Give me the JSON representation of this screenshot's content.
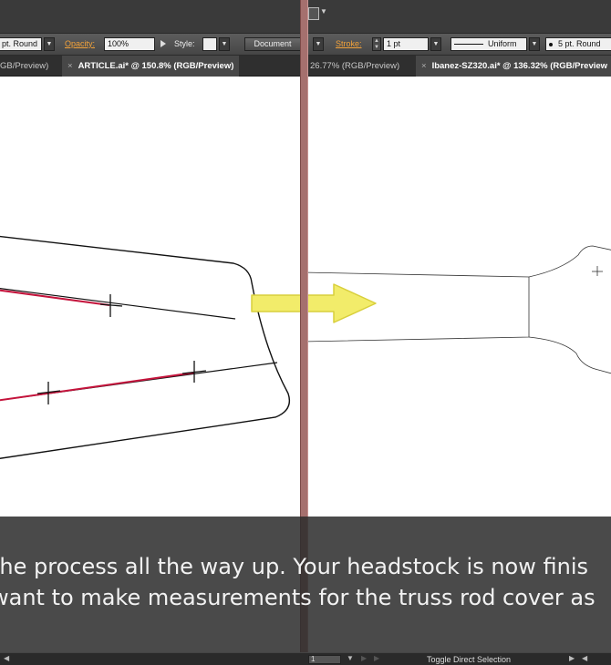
{
  "control_bar": {
    "brush_value": "pt. Round",
    "opacity_label": "Opacity:",
    "opacity_value": "100%",
    "style_label": "Style:",
    "document_label": "Document",
    "stroke_label": "Stroke:",
    "stroke_weight": "1 pt",
    "profile_value": "Uniform",
    "brush2_value": "5 pt. Round"
  },
  "left_tabs": [
    {
      "label": "GB/Preview)"
    },
    {
      "label": "ARTICLE.ai* @ 150.8% (RGB/Preview)",
      "close": "×"
    }
  ],
  "right_tabs": [
    {
      "label": "26.77% (RGB/Preview)"
    },
    {
      "label": "Ibanez-SZ320.ai* @ 136.32% (RGB/Preview",
      "close": "×"
    }
  ],
  "caption": {
    "line1": "the process all the way up. Your headstock is now finis",
    "line2": "want to make measurements for the truss rod cover as"
  },
  "status_bar": {
    "zoom_value": "1",
    "status_text": "Toggle Direct Selection"
  },
  "colors": {
    "guide_red": "#c4143c",
    "arrow_yellow": "#f2ec6a",
    "divider": "#a5706e"
  }
}
